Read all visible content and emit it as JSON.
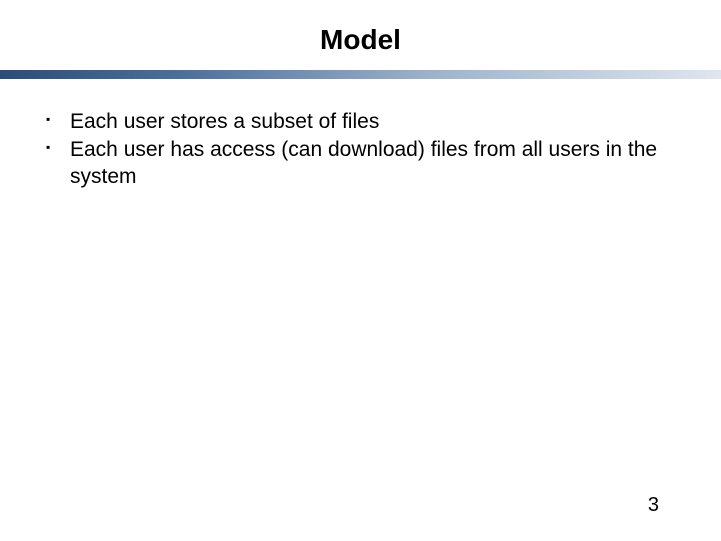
{
  "slide": {
    "title": "Model",
    "bullets": [
      "Each user stores a subset of files",
      "Each user has access (can download) files from all users in the system"
    ],
    "page_number": "3"
  }
}
